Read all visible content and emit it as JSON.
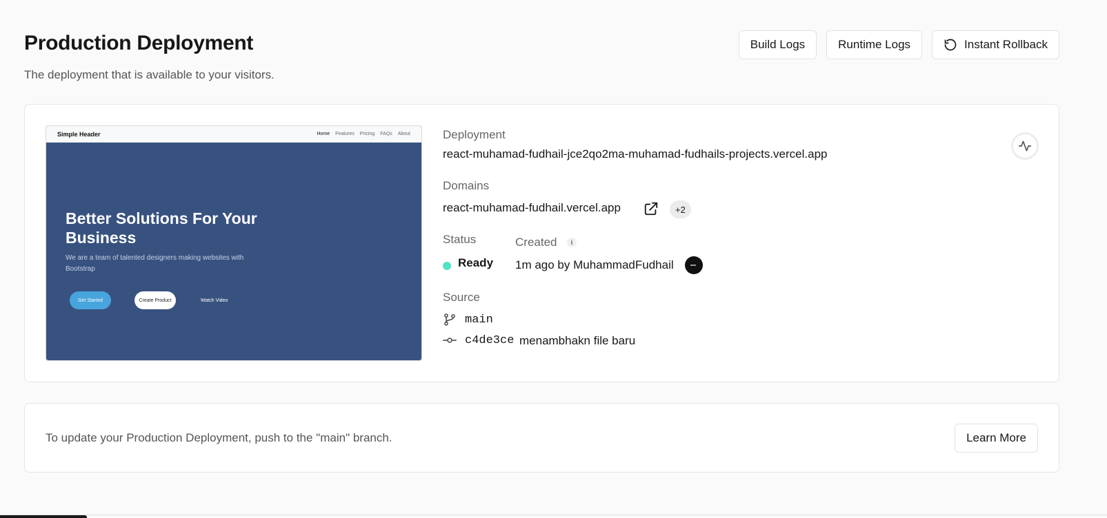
{
  "header": {
    "title": "Production Deployment",
    "subtitle": "The deployment that is available to your visitors.",
    "buttons": {
      "build_logs": "Build Logs",
      "runtime_logs": "Runtime Logs",
      "instant_rollback": "Instant Rollback"
    }
  },
  "preview": {
    "brand": "Simple Header",
    "nav": [
      "Home",
      "Features",
      "Pricing",
      "FAQs",
      "About"
    ],
    "headline": "Better Solutions For Your Business",
    "paragraph": "We are a team of talented designers making websites with Bootstrap",
    "btn_get_started": "Get Started",
    "btn_create_product": "Create Product",
    "btn_watch_video": "Watch Video"
  },
  "deployment": {
    "label": "Deployment",
    "url": "react-muhamad-fudhail-jce2qo2ma-muhamad-fudhails-projects.vercel.app"
  },
  "domains": {
    "label": "Domains",
    "primary": "react-muhamad-fudhail.vercel.app",
    "extra_count": "+2"
  },
  "status": {
    "label": "Status",
    "value": "Ready",
    "color": "#50e3c2"
  },
  "created": {
    "label": "Created",
    "info_glyph": "i",
    "value": "1m ago by MuhammadFudhail"
  },
  "source": {
    "label": "Source",
    "branch": "main",
    "commit_hash": "c4de3ce",
    "commit_message": "menambhakn file baru"
  },
  "footer_card": {
    "text": "To update your Production Deployment, push to the \"main\" branch.",
    "learn_more": "Learn More"
  },
  "icons": {
    "rollback": "rotate-ccw-icon",
    "external_link": "external-link-icon",
    "git_branch": "git-branch-icon",
    "git_commit": "git-commit-icon",
    "activity": "activity-icon",
    "info": "info-icon"
  }
}
